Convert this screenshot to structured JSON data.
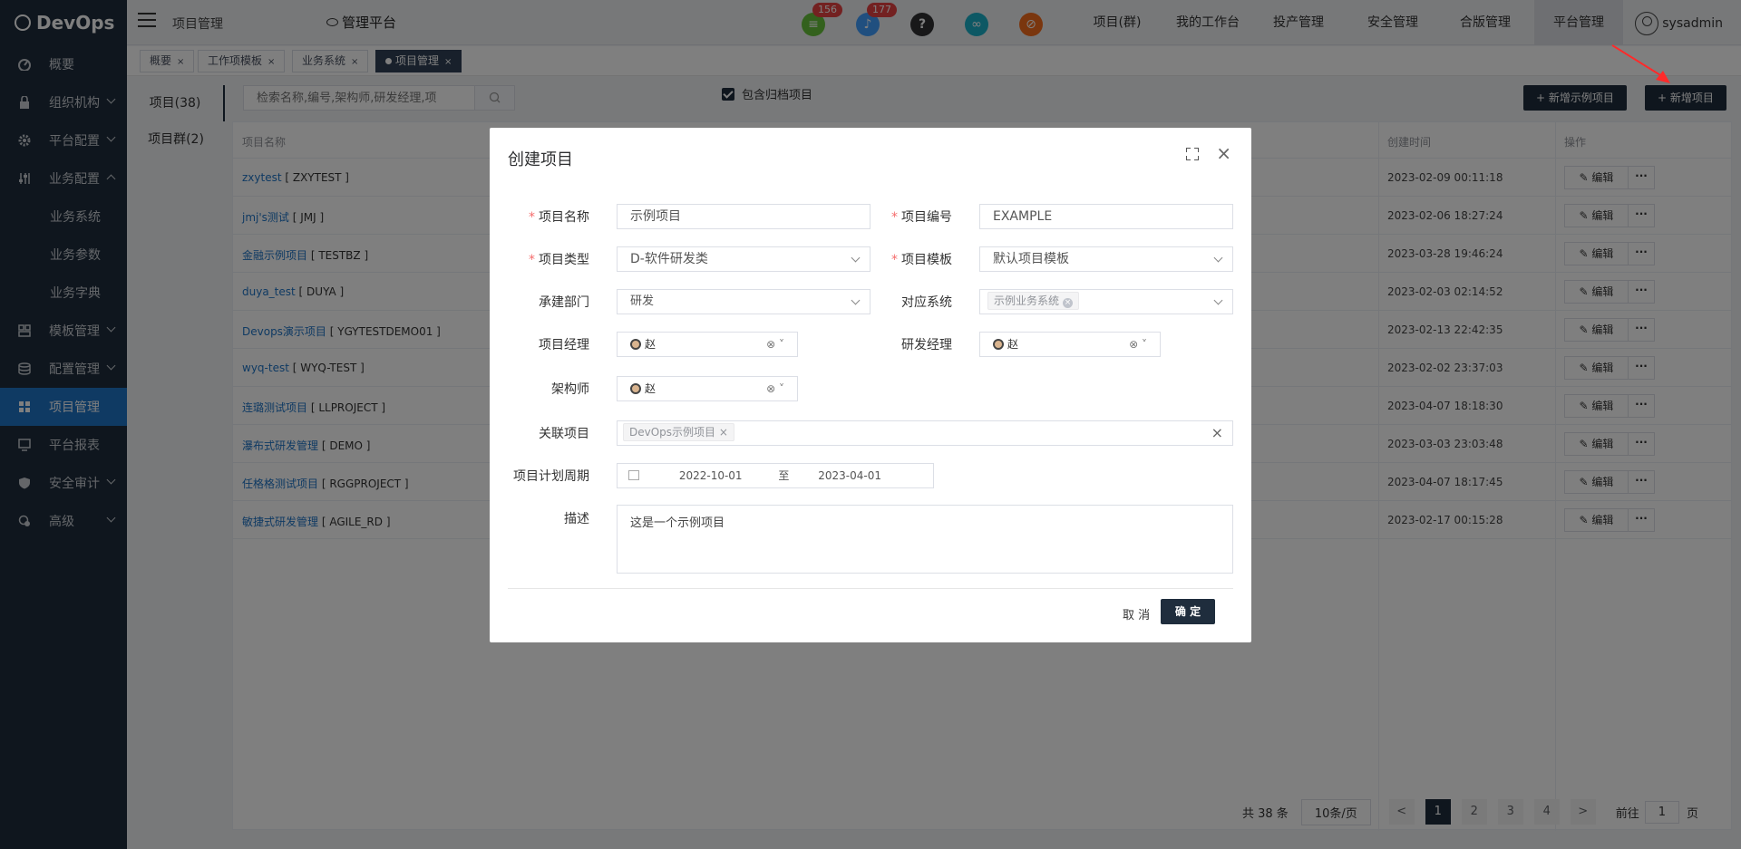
{
  "app": {
    "logo_text": "DevOps"
  },
  "sidebar": {
    "items": [
      {
        "label": "概要",
        "icon": "dashboard-icon"
      },
      {
        "label": "组织机构",
        "icon": "lock-icon",
        "expand": "down"
      },
      {
        "label": "平台配置",
        "icon": "gear-icon",
        "expand": "down"
      },
      {
        "label": "业务配置",
        "icon": "sliders-icon",
        "expand": "up"
      },
      {
        "label": "模板管理",
        "icon": "template-icon",
        "expand": "down"
      },
      {
        "label": "配置管理",
        "icon": "database-icon",
        "expand": "down"
      },
      {
        "label": "项目管理",
        "icon": "grid-icon",
        "active": true
      },
      {
        "label": "平台报表",
        "icon": "monitor-icon"
      },
      {
        "label": "安全审计",
        "icon": "shield-icon",
        "expand": "down"
      },
      {
        "label": "高级",
        "icon": "advanced-icon",
        "expand": "down"
      }
    ],
    "sub_items": [
      "业务系统",
      "业务参数",
      "业务字典"
    ]
  },
  "header": {
    "breadcrumb": "项目管理",
    "platform": "管理平台",
    "icons": [
      {
        "name": "document-icon",
        "color": "#67c23a",
        "badge": "156"
      },
      {
        "name": "bell-icon",
        "color": "#409eff",
        "badge": "177"
      },
      {
        "name": "help-icon",
        "color": "#303133"
      },
      {
        "name": "link-icon",
        "color": "#1ab0c8"
      },
      {
        "name": "block-icon",
        "color": "#f56c1c"
      }
    ],
    "nav": [
      "项目(群)",
      "我的工作台",
      "投产管理",
      "安全管理",
      "合版管理",
      "平台管理"
    ],
    "user": "sysadmin"
  },
  "tabs": [
    {
      "label": "概要"
    },
    {
      "label": "工作项模板"
    },
    {
      "label": "业务系统"
    },
    {
      "label": "项目管理",
      "active": true
    }
  ],
  "content": {
    "left_tabs": [
      "项目(38)",
      "项目群(2)"
    ],
    "search_placeholder": "检索名称,编号,架构师,研发经理,项",
    "archive_label": "包含归档项目",
    "btn_example": "+ 新增示例项目",
    "btn_new": "+ 新增项目",
    "columns": {
      "name": "项目名称",
      "created": "创建时间",
      "ops": "操作"
    },
    "edit_label": "编辑",
    "more_label": "···",
    "rows": [
      {
        "link": "zxytest",
        "code": " [ ZXYTEST ]",
        "created": "2023-02-09 00:11:18"
      },
      {
        "link": "jmj's测试",
        "code": " [ JMJ ]",
        "created": "2023-02-06 18:27:24"
      },
      {
        "link": "金融示例项目",
        "code": " [ TESTBZ ]",
        "created": "2023-03-28 19:46:24"
      },
      {
        "link": "duya_test",
        "code": " [ DUYA ]",
        "created": "2023-02-03 02:14:52"
      },
      {
        "link": "Devops演示项目",
        "code": " [ YGYTESTDEMO01 ]",
        "created": "2023-02-13 22:42:35"
      },
      {
        "link": "wyq-test",
        "code": " [ WYQ-TEST ]",
        "created": "2023-02-02 23:37:03"
      },
      {
        "link": "连璐测试项目",
        "code": " [ LLPROJECT ]",
        "created": "2023-04-07 18:18:30"
      },
      {
        "link": "瀑布式研发管理",
        "code": " [ DEMO ]",
        "created": "2023-03-03 23:03:48"
      },
      {
        "link": "任格格测试项目",
        "code": " [ RGGPROJECT ]",
        "created": "2023-04-07 18:17:45"
      },
      {
        "link": "敏捷式研发管理",
        "code": " [ AGILE_RD ]",
        "created": "2023-02-17 00:15:28"
      }
    ],
    "pager": {
      "total": "共 38 条",
      "page_size": "10条/页",
      "prev": "<",
      "pages": [
        "1",
        "2",
        "3",
        "4"
      ],
      "next": ">",
      "goto_label": "前往",
      "goto_value": "1",
      "goto_suffix": "页"
    }
  },
  "dialog": {
    "title": "创建项目",
    "fields": {
      "name": {
        "label": "项目名称",
        "value": "示例项目"
      },
      "code": {
        "label": "项目编号",
        "value": "EXAMPLE"
      },
      "type": {
        "label": "项目类型",
        "value": "D-软件研发类"
      },
      "template": {
        "label": "项目模板",
        "value": "默认项目模板"
      },
      "dept": {
        "label": "承建部门",
        "value": "研发"
      },
      "system": {
        "label": "对应系统",
        "tag": "示例业务系统"
      },
      "pm": {
        "label": "项目经理",
        "value": "赵"
      },
      "rdm": {
        "label": "研发经理",
        "value": "赵"
      },
      "architect": {
        "label": "架构师",
        "value": "赵"
      },
      "related": {
        "label": "关联项目",
        "tag": "DevOps示例项目"
      },
      "period": {
        "label": "项目计划周期",
        "start": "2022-10-01",
        "sep": "至",
        "end": "2023-04-01"
      },
      "desc": {
        "label": "描述",
        "value": "这是一个示例项目"
      }
    },
    "cancel": "取 消",
    "ok": "确 定"
  }
}
